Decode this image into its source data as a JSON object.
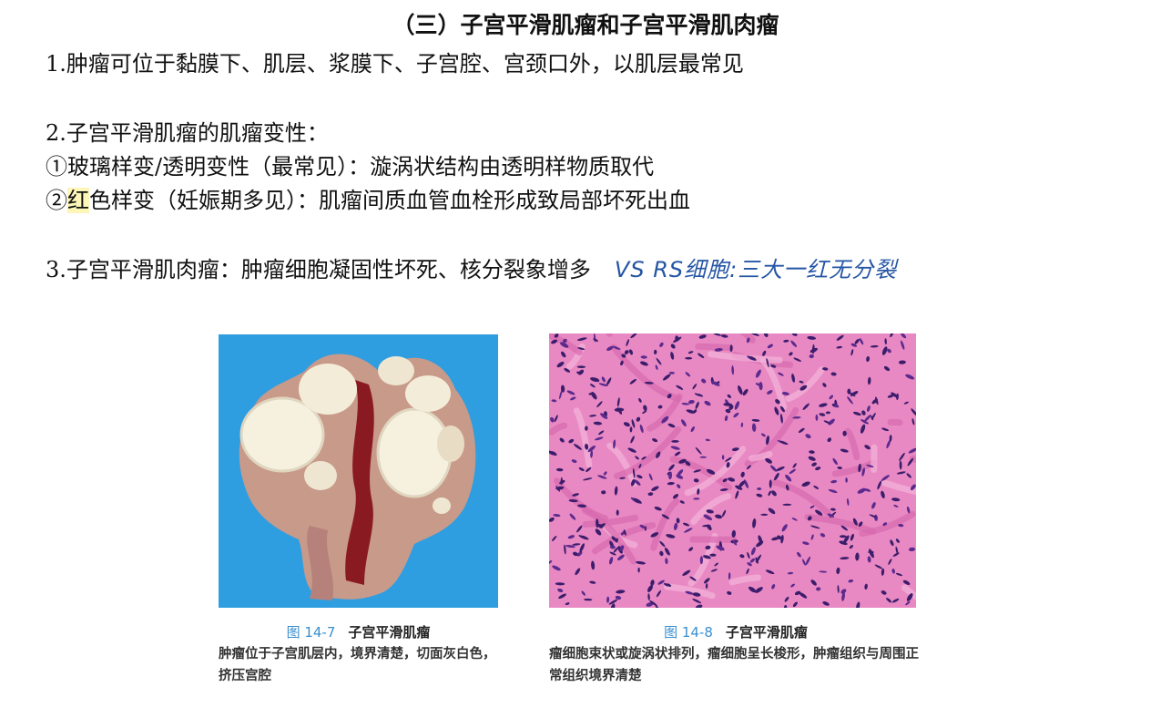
{
  "title": "（三）子宫平滑肌瘤和子宫平滑肌肉瘤",
  "lines": {
    "l1": "1.肿瘤可位于黏膜下、肌层、浆膜下、子宫腔、宫颈口外，以肌层最常见",
    "l2": "2.子宫平滑肌瘤的肌瘤变性：",
    "l3": "①玻璃样变/透明变性（最常见）：漩涡状结构由透明样物质取代",
    "l4_a": "②",
    "l4_b": "红",
    "l4_c": "色样变（妊娠期多见）：肌瘤间质血管血栓形成致局部坏死出血",
    "l5": "3.子宫平滑肌肉瘤：肿瘤细胞凝固性坏死、核分裂象增多",
    "l5_note": "VS RS细胞:三大一红无分裂"
  },
  "figures": {
    "left": {
      "number": "图 14-7",
      "title": "子宫平滑肌瘤",
      "desc": "肿瘤位于子宫肌层内，境界清楚，切面灰白色，挤压宫腔",
      "bg_color": "#2f9ee0"
    },
    "right": {
      "number": "图 14-8",
      "title": "子宫平滑肌瘤",
      "desc": "瘤细胞束状或旋涡状排列，瘤细胞呈长梭形，肿瘤组织与周围正常组织境界清楚",
      "bg_color": "#e889c3"
    }
  }
}
